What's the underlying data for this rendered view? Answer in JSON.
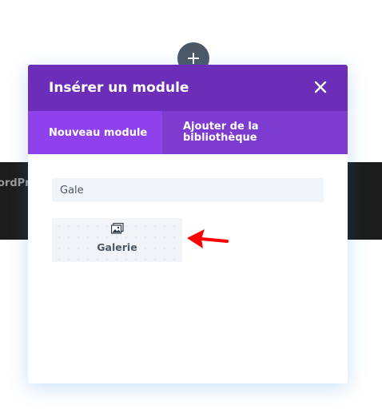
{
  "background": {
    "band_text": "ordPr"
  },
  "add_button": {
    "icon": "plus-icon"
  },
  "modal": {
    "title": "Insérer un module",
    "close_icon": "close-icon",
    "tabs": [
      {
        "label": "Nouveau module",
        "active": true
      },
      {
        "label": "Ajouter de la bibliothèque",
        "active": false
      }
    ],
    "search": {
      "value": "Gale",
      "placeholder": ""
    },
    "modules": [
      {
        "label": "Galerie",
        "icon": "gallery-icon"
      }
    ]
  },
  "annotation": {
    "icon": "red-arrow-icon",
    "color": "#ff0000"
  },
  "colors": {
    "header": "#6c2eb9",
    "tabs": "#7e3bd0",
    "active_tab": "#8f42ec",
    "input_bg": "#f1f5f9",
    "text": "#4c5866"
  }
}
